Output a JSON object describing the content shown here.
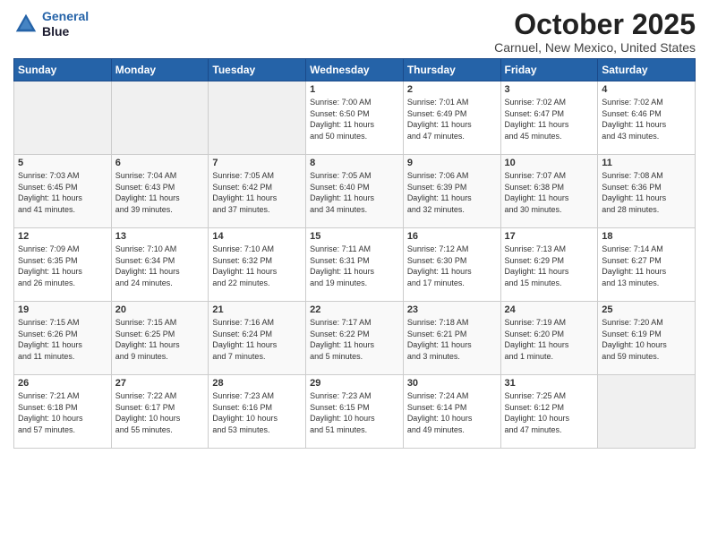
{
  "header": {
    "logo_line1": "General",
    "logo_line2": "Blue",
    "month": "October 2025",
    "location": "Carnuel, New Mexico, United States"
  },
  "weekdays": [
    "Sunday",
    "Monday",
    "Tuesday",
    "Wednesday",
    "Thursday",
    "Friday",
    "Saturday"
  ],
  "weeks": [
    [
      {
        "day": "",
        "info": ""
      },
      {
        "day": "",
        "info": ""
      },
      {
        "day": "",
        "info": ""
      },
      {
        "day": "1",
        "info": "Sunrise: 7:00 AM\nSunset: 6:50 PM\nDaylight: 11 hours\nand 50 minutes."
      },
      {
        "day": "2",
        "info": "Sunrise: 7:01 AM\nSunset: 6:49 PM\nDaylight: 11 hours\nand 47 minutes."
      },
      {
        "day": "3",
        "info": "Sunrise: 7:02 AM\nSunset: 6:47 PM\nDaylight: 11 hours\nand 45 minutes."
      },
      {
        "day": "4",
        "info": "Sunrise: 7:02 AM\nSunset: 6:46 PM\nDaylight: 11 hours\nand 43 minutes."
      }
    ],
    [
      {
        "day": "5",
        "info": "Sunrise: 7:03 AM\nSunset: 6:45 PM\nDaylight: 11 hours\nand 41 minutes."
      },
      {
        "day": "6",
        "info": "Sunrise: 7:04 AM\nSunset: 6:43 PM\nDaylight: 11 hours\nand 39 minutes."
      },
      {
        "day": "7",
        "info": "Sunrise: 7:05 AM\nSunset: 6:42 PM\nDaylight: 11 hours\nand 37 minutes."
      },
      {
        "day": "8",
        "info": "Sunrise: 7:05 AM\nSunset: 6:40 PM\nDaylight: 11 hours\nand 34 minutes."
      },
      {
        "day": "9",
        "info": "Sunrise: 7:06 AM\nSunset: 6:39 PM\nDaylight: 11 hours\nand 32 minutes."
      },
      {
        "day": "10",
        "info": "Sunrise: 7:07 AM\nSunset: 6:38 PM\nDaylight: 11 hours\nand 30 minutes."
      },
      {
        "day": "11",
        "info": "Sunrise: 7:08 AM\nSunset: 6:36 PM\nDaylight: 11 hours\nand 28 minutes."
      }
    ],
    [
      {
        "day": "12",
        "info": "Sunrise: 7:09 AM\nSunset: 6:35 PM\nDaylight: 11 hours\nand 26 minutes."
      },
      {
        "day": "13",
        "info": "Sunrise: 7:10 AM\nSunset: 6:34 PM\nDaylight: 11 hours\nand 24 minutes."
      },
      {
        "day": "14",
        "info": "Sunrise: 7:10 AM\nSunset: 6:32 PM\nDaylight: 11 hours\nand 22 minutes."
      },
      {
        "day": "15",
        "info": "Sunrise: 7:11 AM\nSunset: 6:31 PM\nDaylight: 11 hours\nand 19 minutes."
      },
      {
        "day": "16",
        "info": "Sunrise: 7:12 AM\nSunset: 6:30 PM\nDaylight: 11 hours\nand 17 minutes."
      },
      {
        "day": "17",
        "info": "Sunrise: 7:13 AM\nSunset: 6:29 PM\nDaylight: 11 hours\nand 15 minutes."
      },
      {
        "day": "18",
        "info": "Sunrise: 7:14 AM\nSunset: 6:27 PM\nDaylight: 11 hours\nand 13 minutes."
      }
    ],
    [
      {
        "day": "19",
        "info": "Sunrise: 7:15 AM\nSunset: 6:26 PM\nDaylight: 11 hours\nand 11 minutes."
      },
      {
        "day": "20",
        "info": "Sunrise: 7:15 AM\nSunset: 6:25 PM\nDaylight: 11 hours\nand 9 minutes."
      },
      {
        "day": "21",
        "info": "Sunrise: 7:16 AM\nSunset: 6:24 PM\nDaylight: 11 hours\nand 7 minutes."
      },
      {
        "day": "22",
        "info": "Sunrise: 7:17 AM\nSunset: 6:22 PM\nDaylight: 11 hours\nand 5 minutes."
      },
      {
        "day": "23",
        "info": "Sunrise: 7:18 AM\nSunset: 6:21 PM\nDaylight: 11 hours\nand 3 minutes."
      },
      {
        "day": "24",
        "info": "Sunrise: 7:19 AM\nSunset: 6:20 PM\nDaylight: 11 hours\nand 1 minute."
      },
      {
        "day": "25",
        "info": "Sunrise: 7:20 AM\nSunset: 6:19 PM\nDaylight: 10 hours\nand 59 minutes."
      }
    ],
    [
      {
        "day": "26",
        "info": "Sunrise: 7:21 AM\nSunset: 6:18 PM\nDaylight: 10 hours\nand 57 minutes."
      },
      {
        "day": "27",
        "info": "Sunrise: 7:22 AM\nSunset: 6:17 PM\nDaylight: 10 hours\nand 55 minutes."
      },
      {
        "day": "28",
        "info": "Sunrise: 7:23 AM\nSunset: 6:16 PM\nDaylight: 10 hours\nand 53 minutes."
      },
      {
        "day": "29",
        "info": "Sunrise: 7:23 AM\nSunset: 6:15 PM\nDaylight: 10 hours\nand 51 minutes."
      },
      {
        "day": "30",
        "info": "Sunrise: 7:24 AM\nSunset: 6:14 PM\nDaylight: 10 hours\nand 49 minutes."
      },
      {
        "day": "31",
        "info": "Sunrise: 7:25 AM\nSunset: 6:12 PM\nDaylight: 10 hours\nand 47 minutes."
      },
      {
        "day": "",
        "info": ""
      }
    ]
  ]
}
